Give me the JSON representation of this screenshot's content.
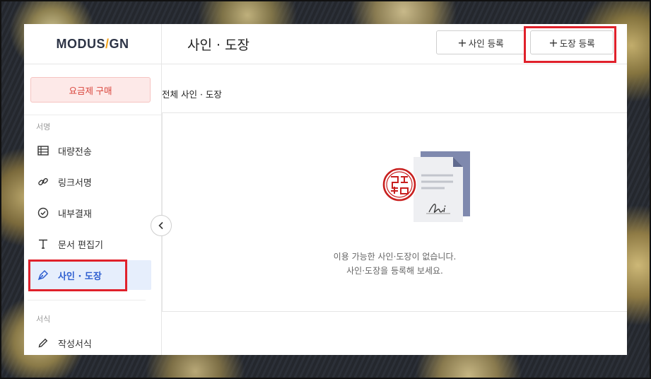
{
  "app": {
    "logo_left": "MODUS",
    "logo_slash": "/",
    "logo_right": "GN"
  },
  "header": {
    "title": "사인 · 도장",
    "sign_register_label": "사인 등록",
    "stamp_register_label": "도장 등록",
    "plus_glyph": "+"
  },
  "sidebar": {
    "buy_label": "요금제 구매",
    "section_sign": "서명",
    "section_form": "서식",
    "items": [
      {
        "label": "대량전송",
        "icon": "table-icon"
      },
      {
        "label": "링크서명",
        "icon": "link-icon"
      },
      {
        "label": "내부결재",
        "icon": "check-circle-icon"
      },
      {
        "label": "문서 편집기",
        "icon": "text-icon"
      },
      {
        "label": "사인 · 도장",
        "icon": "pen-nib-icon",
        "active": true
      },
      {
        "label": "작성서식",
        "icon": "pencil-icon"
      }
    ]
  },
  "main": {
    "list_title": "전체 사인 · 도장",
    "empty_line1": "이용 가능한 사인·도장이 없습니다.",
    "empty_line2": "사인·도장을 등록해 보세요."
  },
  "colors": {
    "highlight": "#e0212b",
    "active_bg": "#e6eefc",
    "active_text": "#2f5fd0",
    "buy_bg": "#fde9e8",
    "buy_text": "#d9453c",
    "logo_accent": "#f3a21b"
  }
}
